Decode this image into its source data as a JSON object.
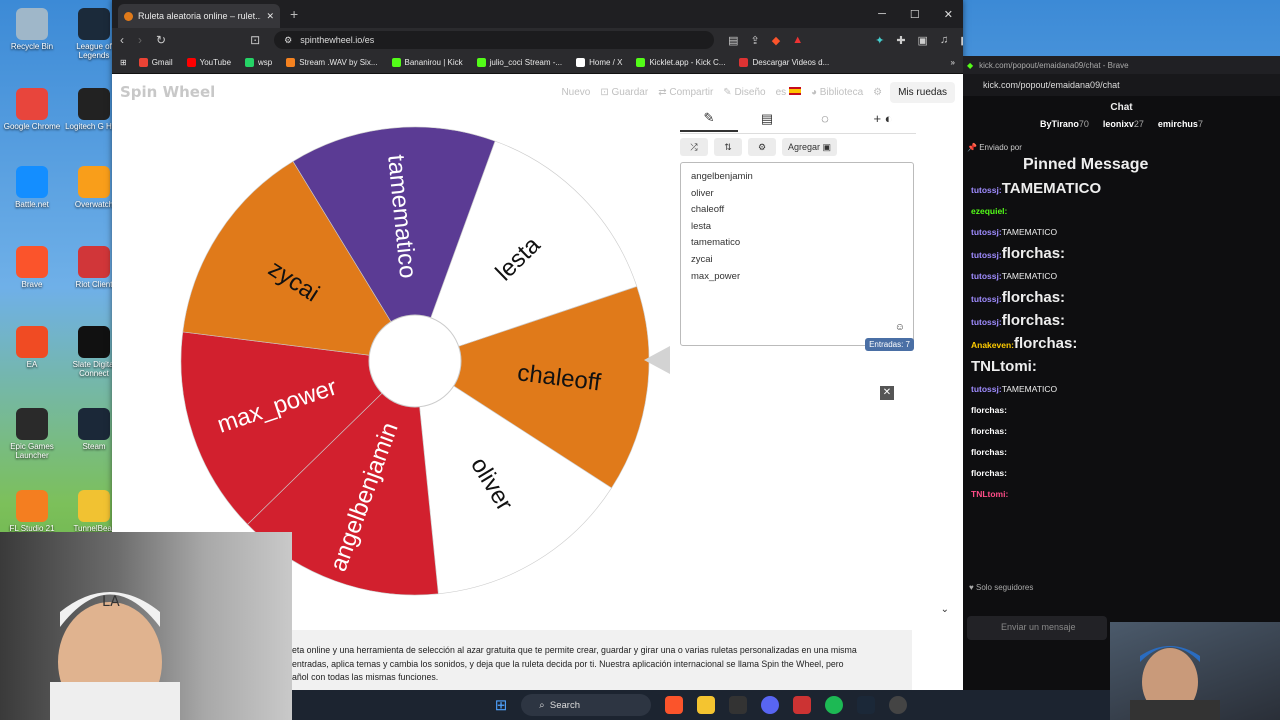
{
  "desktop": {
    "icons": [
      {
        "label": "Recycle Bin",
        "color": "#9fb7c9"
      },
      {
        "label": "League of Legends",
        "color": "#1b2a3a"
      },
      {
        "label": "Google Chrome",
        "color": "#e8453c"
      },
      {
        "label": "Logitech G HUB",
        "color": "#222"
      },
      {
        "label": "Battle.net",
        "color": "#148eff"
      },
      {
        "label": "Overwatch",
        "color": "#f99e1a"
      },
      {
        "label": "Brave",
        "color": "#fb542b"
      },
      {
        "label": "Riot Client",
        "color": "#d13639"
      },
      {
        "label": "EA",
        "color": "#f04b23"
      },
      {
        "label": "Slate Digital Connect",
        "color": "#111"
      },
      {
        "label": "Epic Games Launcher",
        "color": "#2a2a2a"
      },
      {
        "label": "Steam",
        "color": "#1b2838"
      },
      {
        "label": "FL Studio 21",
        "color": "#f47e20"
      },
      {
        "label": "TunnelBear",
        "color": "#f1c232"
      }
    ]
  },
  "browser": {
    "tab_title": "Ruleta aleatoria online – rulet...",
    "new_tab": "+",
    "url": "spinthewheel.io/es",
    "bookmarks": [
      {
        "label": "Gmail",
        "color": "#ea4335"
      },
      {
        "label": "YouTube",
        "color": "#ff0000"
      },
      {
        "label": "wsp",
        "color": "#25d366"
      },
      {
        "label": "Stream .WAV by Six...",
        "color": "#f58220"
      },
      {
        "label": "Bananirou | Kick",
        "color": "#53fc18"
      },
      {
        "label": "julio_coci Stream -...",
        "color": "#53fc18"
      },
      {
        "label": "Home / X",
        "color": "#ffffff"
      },
      {
        "label": "Kicklet.app - Kick C...",
        "color": "#53fc18"
      },
      {
        "label": "Descargar Videos d...",
        "color": "#d33"
      }
    ]
  },
  "site": {
    "logo": "Spin Wheel",
    "menu": [
      "Nuevo",
      "Guardar",
      "Compartir",
      "Diseño",
      "es",
      "Biblioteca"
    ],
    "my_wheels": "Mis ruedas",
    "add_button": "Agregar",
    "entries": [
      "angelbenjamin",
      "oliver",
      "chaleoff",
      "lesta",
      "tamematico",
      "zycai",
      "max_power"
    ],
    "entries_badge": "Entradas: 7",
    "description": [
      "eta online y una herramienta de selección al azar gratuita que te permite crear, guardar y girar una o varias ruletas personalizadas en una misma",
      "entradas, aplica temas y cambia los sonidos, y deja que la ruleta decida por ti. Nuestra aplicación internacional se llama Spin the Wheel, pero",
      "añol con todas las mismas funciones."
    ]
  },
  "wheel": {
    "start_angle_deg": -70,
    "segments": [
      {
        "label": "lesta",
        "color": "#ffffff",
        "text_color": "#111"
      },
      {
        "label": "chaleoff",
        "color": "#e07a1a",
        "text_color": "#111"
      },
      {
        "label": "oliver",
        "color": "#ffffff",
        "text_color": "#111"
      },
      {
        "label": "angelbenjamin",
        "color": "#d2202e",
        "text_color": "#fff"
      },
      {
        "label": "max_power",
        "color": "#d2202e",
        "text_color": "#fff"
      },
      {
        "label": "zycai",
        "color": "#e07a1a",
        "text_color": "#111"
      },
      {
        "label": "tamematico",
        "color": "#5b3b94",
        "text_color": "#fff"
      }
    ]
  },
  "chat": {
    "window_title": "kick.com/popout/emaidana09/chat - Brave",
    "url": "kick.com/popout/emaidana09/chat",
    "header": "Chat",
    "gifters": [
      {
        "name": "ByTirano",
        "count": "70"
      },
      {
        "name": "leonixv",
        "count": "27"
      },
      {
        "name": "emirchus",
        "count": "7"
      }
    ],
    "pinned_by": "Enviado por",
    "pinned_title": "Pinned Message",
    "messages": [
      {
        "user": "tutossj:",
        "text": "TAMEMATICO",
        "color": "#9f8cff",
        "big": true
      },
      {
        "user": "ezequiel:",
        "text": "",
        "color": "#53fc18",
        "big": false
      },
      {
        "user": "tutossj:",
        "text": "TAMEMATICO",
        "color": "#9f8cff",
        "big": false
      },
      {
        "user": "tutossj:",
        "text": "florchas:",
        "color": "#9f8cff",
        "big": true
      },
      {
        "user": "tutossj:",
        "text": "TAMEMATICO",
        "color": "#9f8cff",
        "big": false
      },
      {
        "user": "tutossj:",
        "text": "florchas:",
        "color": "#9f8cff",
        "big": true
      },
      {
        "user": "tutossj:",
        "text": "florchas:",
        "color": "#9f8cff",
        "big": true
      },
      {
        "user": "Anakeven:",
        "text": "florchas:",
        "color": "#ffcc00",
        "big": true
      },
      {
        "user": "",
        "text": "TNLtomi:",
        "color": "#ff4d88",
        "big": true
      },
      {
        "user": "tutossj:",
        "text": "TAMEMATICO",
        "color": "#9f8cff",
        "big": false
      },
      {
        "user": "florchas:",
        "text": "",
        "color": "#ffffff",
        "big": false
      },
      {
        "user": "florchas:",
        "text": "",
        "color": "#ffffff",
        "big": false
      },
      {
        "user": "florchas:",
        "text": "",
        "color": "#ffffff",
        "big": false
      },
      {
        "user": "florchas:",
        "text": "",
        "color": "#ffffff",
        "big": false
      },
      {
        "user": "TNLtomi:",
        "text": "",
        "color": "#ff4d88",
        "big": false
      }
    ],
    "followers_only": "Solo seguidores",
    "input_placeholder": "Enviar un mensaje"
  },
  "taskbar": {
    "search": "Search"
  }
}
